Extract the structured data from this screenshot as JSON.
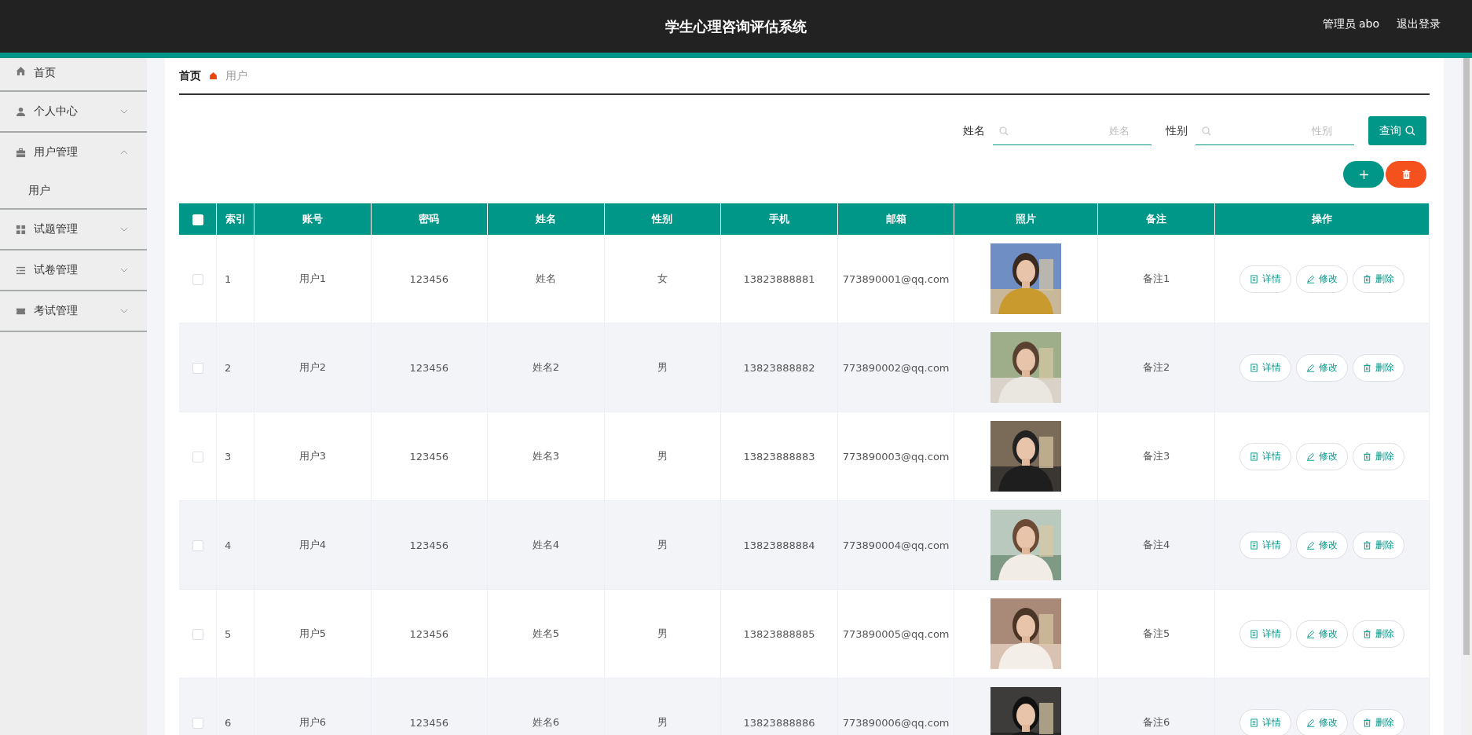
{
  "header": {
    "title": "学生心理咨询评估系统",
    "user": "管理员 abo",
    "logout": "退出登录"
  },
  "sidebar": {
    "items": [
      {
        "label": "首页"
      },
      {
        "label": "个人中心",
        "expanded": false
      },
      {
        "label": "用户管理",
        "expanded": true,
        "children": [
          {
            "label": "用户"
          }
        ]
      },
      {
        "label": "试题管理",
        "expanded": false
      },
      {
        "label": "试卷管理",
        "expanded": false
      },
      {
        "label": "考试管理",
        "expanded": false
      }
    ]
  },
  "breadcrumb": [
    "首页",
    "用户"
  ],
  "search": {
    "fields": [
      {
        "label": "姓名",
        "placeholder": "姓名"
      },
      {
        "label": "性别",
        "placeholder": "性别"
      }
    ],
    "button": "查询"
  },
  "table": {
    "all_checked": false,
    "columns": [
      "索引",
      "账号",
      "密码",
      "姓名",
      "性别",
      "手机",
      "邮箱",
      "照片",
      "备注",
      "操作"
    ],
    "rows": [
      {
        "checked": false,
        "cells": [
          "1",
          "用户1",
          "123456",
          "姓名",
          "女",
          "13823888881",
          "773890001@qq.com"
        ],
        "note": "备注1",
        "actions": [
          {
            "kind": "detail",
            "label": "详情"
          },
          {
            "kind": "edit",
            "label": "修改"
          },
          {
            "kind": "delete",
            "label": "删除"
          }
        ]
      },
      {
        "checked": false,
        "cells": [
          "2",
          "用户2",
          "123456",
          "姓名2",
          "男",
          "13823888882",
          "773890002@qq.com"
        ],
        "note": "备注2",
        "actions": [
          {
            "kind": "detail",
            "label": "详情"
          },
          {
            "kind": "edit",
            "label": "修改"
          },
          {
            "kind": "delete",
            "label": "删除"
          }
        ]
      },
      {
        "checked": false,
        "cells": [
          "3",
          "用户3",
          "123456",
          "姓名3",
          "男",
          "13823888883",
          "773890003@qq.com"
        ],
        "note": "备注3",
        "actions": [
          {
            "kind": "detail",
            "label": "详情"
          },
          {
            "kind": "edit",
            "label": "修改"
          },
          {
            "kind": "delete",
            "label": "删除"
          }
        ]
      },
      {
        "checked": false,
        "cells": [
          "4",
          "用户4",
          "123456",
          "姓名4",
          "男",
          "13823888884",
          "773890004@qq.com"
        ],
        "note": "备注4",
        "actions": [
          {
            "kind": "detail",
            "label": "详情"
          },
          {
            "kind": "edit",
            "label": "修改"
          },
          {
            "kind": "delete",
            "label": "删除"
          }
        ]
      },
      {
        "checked": false,
        "cells": [
          "5",
          "用户5",
          "123456",
          "姓名5",
          "男",
          "13823888885",
          "773890005@qq.com"
        ],
        "note": "备注5",
        "actions": [
          {
            "kind": "detail",
            "label": "详情"
          },
          {
            "kind": "edit",
            "label": "修改"
          },
          {
            "kind": "delete",
            "label": "删除"
          }
        ]
      },
      {
        "checked": false,
        "cells": [
          "6",
          "用户6",
          "123456",
          "姓名6",
          "男",
          "13823888886",
          "773890006@qq.com"
        ],
        "note": "备注6",
        "actions": [
          {
            "kind": "detail",
            "label": "详情"
          },
          {
            "kind": "edit",
            "label": "修改"
          },
          {
            "kind": "delete",
            "label": "删除"
          }
        ]
      }
    ]
  }
}
